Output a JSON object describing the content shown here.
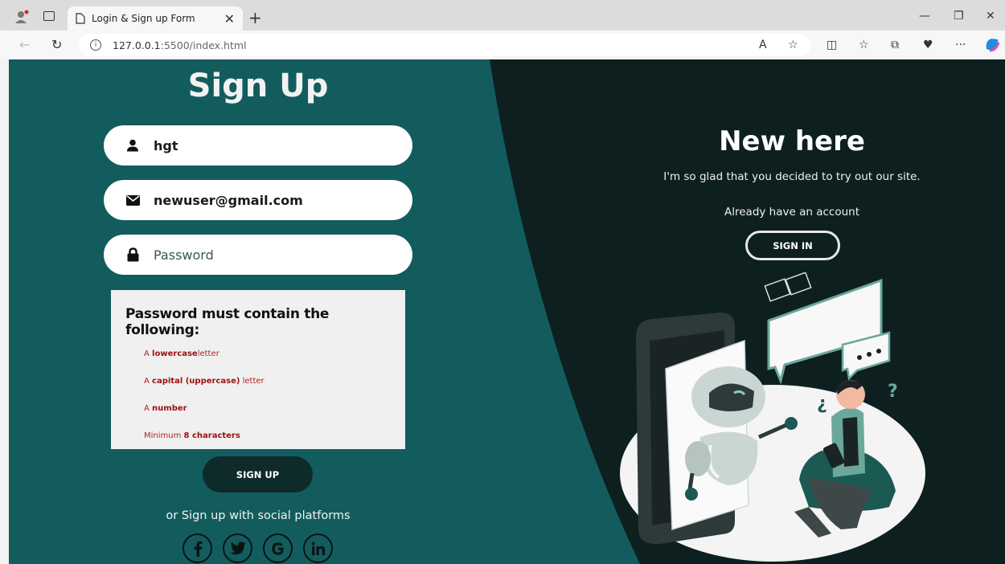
{
  "browser": {
    "tab_title": "Login & Sign up Form",
    "url_host": "127.0.0.1",
    "url_rest": ":5500/index.html",
    "new_tab_symbol": "+",
    "close_symbol": "✕"
  },
  "signup": {
    "title": "Sign Up",
    "username_value": "hgt",
    "email_value": "newuser@gmail.com",
    "password_placeholder": "Password",
    "rules_title": "Password must contain the following:",
    "rules": [
      {
        "pre": "A ",
        "strong": "lowercase",
        "post": "letter"
      },
      {
        "pre": "A ",
        "strong": "capital (uppercase)",
        "post": " letter"
      },
      {
        "pre": "A ",
        "strong": "number",
        "post": ""
      },
      {
        "pre": "Minimum ",
        "strong": "8 characters",
        "post": ""
      }
    ],
    "button_label": "SIGN UP",
    "social_text": "or Sign up with social platforms",
    "social": [
      "facebook",
      "twitter",
      "google",
      "linkedin"
    ]
  },
  "panel": {
    "title": "New here",
    "description": "I'm so glad that you decided to try out our site.",
    "already": "Already have an account",
    "signin_label": "SIGN IN"
  },
  "colors": {
    "teal": "#125c5e",
    "dark": "#0e1f1f",
    "button_dark": "#0f2a2a",
    "rule_red": "#b22222"
  }
}
